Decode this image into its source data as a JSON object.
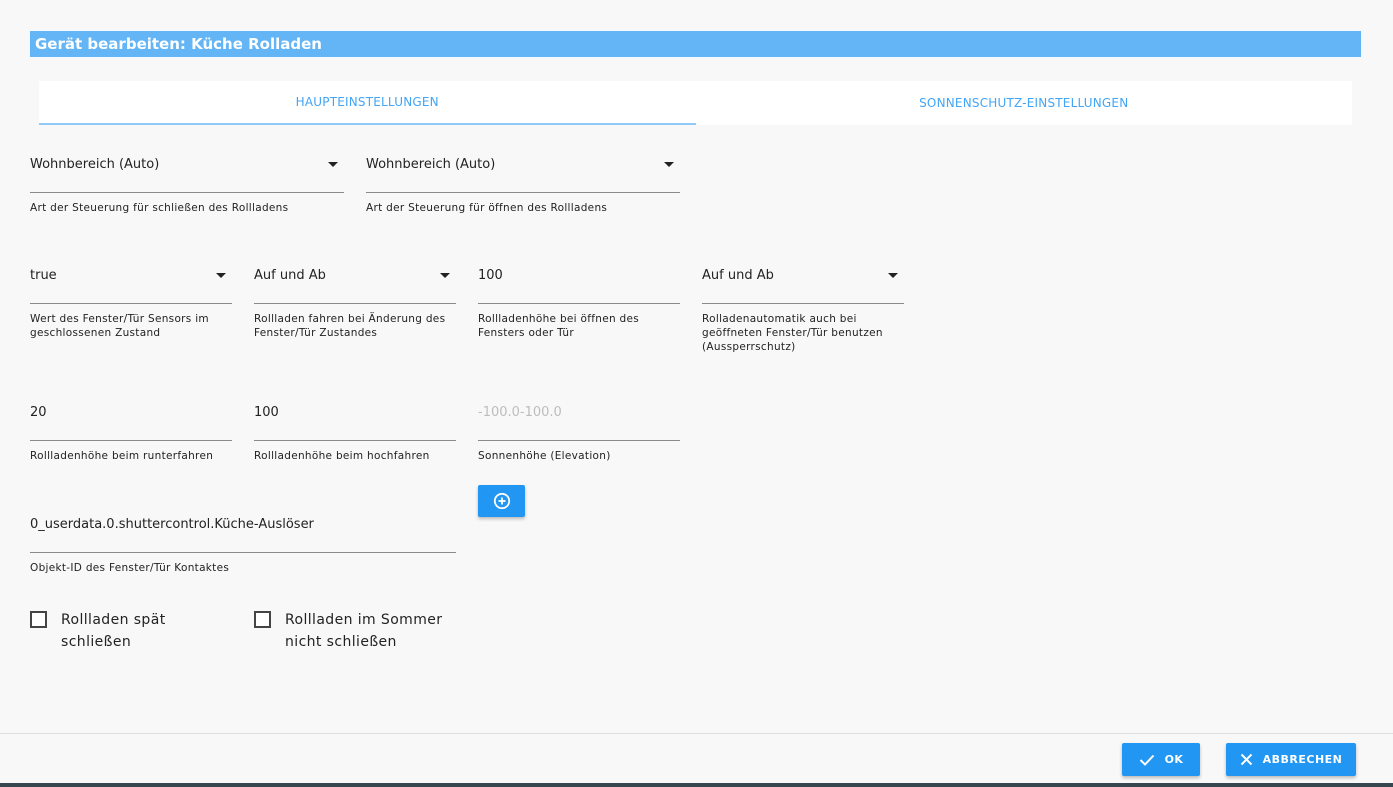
{
  "dialog": {
    "title": "Gerät bearbeiten: Küche Rolladen"
  },
  "tabs": [
    {
      "label": "HAUPTEINSTELLUNGEN",
      "active": true
    },
    {
      "label": "SONNENSCHUTZ-EINSTELLUNGEN",
      "active": false
    }
  ],
  "fields": {
    "close_control": {
      "value": "Wohnbereich (Auto)",
      "helper": "Art der Steuerung für schließen des Rollladens"
    },
    "open_control": {
      "value": "Wohnbereich (Auto)",
      "helper": "Art der Steuerung für öffnen des Rollladens"
    },
    "sensor_value": {
      "value": "true",
      "helper": "Wert des Fenster/Tür Sensors im geschlossenen Zustand"
    },
    "drive_on_change": {
      "value": "Auf und Ab",
      "helper": "Rollladen fahren bei Änderung des Fenster/Tür Zustandes"
    },
    "height_on_open": {
      "value": "100",
      "helper": "Rollladenhöhe bei öffnen des Fensters oder Tür"
    },
    "lockout_protection": {
      "value": "Auf und Ab",
      "helper": "Rolladenautomatik auch bei geöffneten Fenster/Tür benutzen (Aussperrschutz)"
    },
    "height_down": {
      "value": "20",
      "helper": "Rollladenhöhe beim runterfahren"
    },
    "height_up": {
      "value": "100",
      "helper": "Rollladenhöhe beim hochfahren"
    },
    "elevation": {
      "placeholder": "-100.0-100.0",
      "helper": "Sonnenhöhe (Elevation)"
    },
    "object_id": {
      "value": "0_userdata.0.shuttercontrol.Küche-Auslöser",
      "helper": "Objekt-ID des Fenster/Tür Kontaktes"
    }
  },
  "checkboxes": {
    "late_close": {
      "label": "Rollladen spät schließen",
      "checked": false
    },
    "summer_no_close": {
      "label": "Rollladen im Sommer nicht schließen",
      "checked": false
    }
  },
  "buttons": {
    "ok": "OK",
    "cancel": "ABBRECHEN"
  },
  "colors": {
    "accent": "#2196f3",
    "title_bar": "#64b5f6",
    "tab_text": "#42a5f5"
  }
}
